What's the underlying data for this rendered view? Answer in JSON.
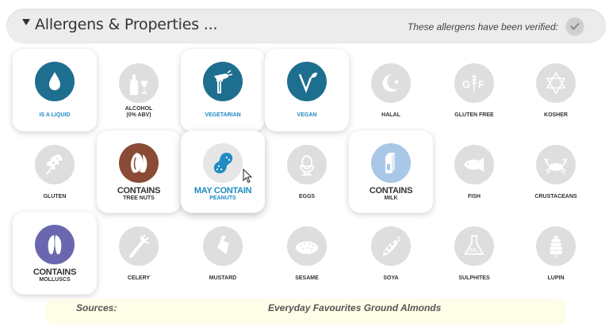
{
  "header": {
    "title": "Allergens & Properties ...",
    "verified_text": "These allergens have been verified:"
  },
  "colors": {
    "active_blue": "#1e6e8f",
    "nuts_brown": "#8a4a35",
    "peanut_blue": "#1e8bc3",
    "milk_light_blue": "#a9c8e8",
    "mollusc_purple": "#6a67b0",
    "inactive_grey": "#dedede"
  },
  "allergens": {
    "liquid": {
      "label": "IS A LIQUID",
      "icon": "droplet-icon"
    },
    "alcohol": {
      "label_line1": "ALCOHOL",
      "label_line2": "(0% ABV)",
      "icon": "wine-bottle-icon"
    },
    "vegetarian": {
      "label": "VEGETARIAN",
      "icon": "fork-carrot-icon"
    },
    "vegan": {
      "label": "VEGAN",
      "icon": "sprout-v-icon"
    },
    "halal": {
      "label": "HALAL",
      "icon": "crescent-star-icon"
    },
    "gluten_free": {
      "label": "GLUTEN FREE",
      "icon": "gf-wheat-icon"
    },
    "kosher": {
      "label": "KOSHER",
      "icon": "star-of-david-icon"
    },
    "gluten": {
      "label": "GLUTEN",
      "icon": "wheat-icon"
    },
    "tree_nuts": {
      "status": "CONTAINS",
      "label": "TREE NUTS",
      "icon": "almond-icon"
    },
    "peanuts": {
      "status": "MAY CONTAIN",
      "label": "PEANUTS",
      "icon": "peanut-icon"
    },
    "eggs": {
      "label": "EGGS",
      "icon": "egg-cup-icon"
    },
    "milk": {
      "status": "CONTAINS",
      "label": "MILK",
      "icon": "milk-carton-icon"
    },
    "fish": {
      "label": "FISH",
      "icon": "fish-icon"
    },
    "crustaceans": {
      "label": "CRUSTACEANS",
      "icon": "crab-icon"
    },
    "molluscs": {
      "status": "CONTAINS",
      "label": "MOLLUSCS",
      "icon": "mussel-icon"
    },
    "celery": {
      "label": "CELERY",
      "icon": "celery-icon"
    },
    "mustard": {
      "label": "MUSTARD",
      "icon": "mustard-bottle-icon"
    },
    "sesame": {
      "label": "SESAME",
      "icon": "bread-icon"
    },
    "soya": {
      "label": "SOYA",
      "icon": "soybean-icon"
    },
    "sulphites": {
      "label": "SULPHITES",
      "icon": "flask-icon",
      "icon_text": "SO₂"
    },
    "lupin": {
      "label": "LUPIN",
      "icon": "lupin-icon"
    }
  },
  "sources": {
    "label": "Sources:",
    "value": "Everyday Favourites Ground Almonds"
  }
}
